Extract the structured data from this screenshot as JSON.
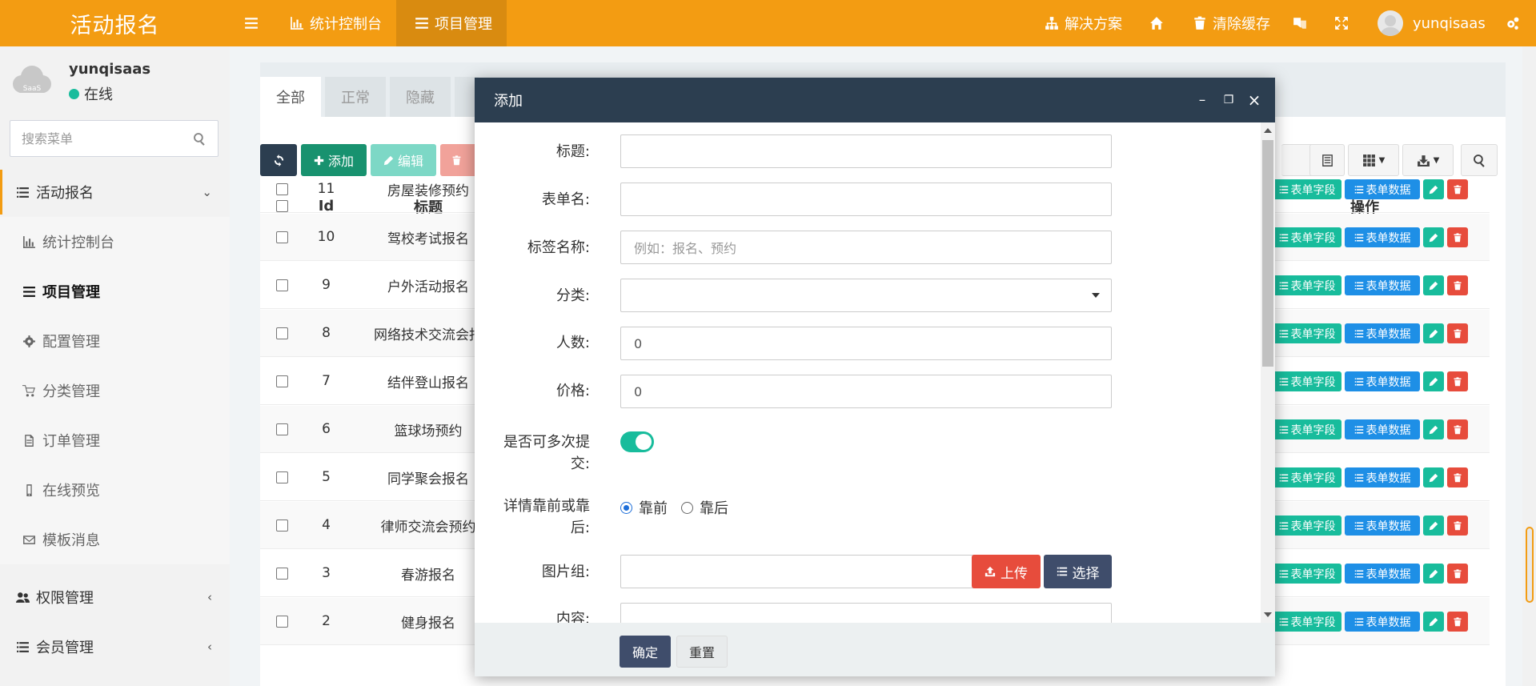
{
  "app": {
    "brand": "活动报名"
  },
  "topnav": {
    "left": [
      {
        "label": "统计控制台"
      },
      {
        "label": "项目管理"
      }
    ],
    "right": {
      "solution": "解决方案",
      "clear_cache": "清除缓存",
      "username": "yunqisaas"
    }
  },
  "sidebar": {
    "user": {
      "name": "yunqisaas",
      "status": "在线",
      "logo_text": "SaaS"
    },
    "search_placeholder": "搜索菜单",
    "groups": [
      {
        "label": "活动报名"
      },
      {
        "label": "权限管理"
      },
      {
        "label": "会员管理"
      }
    ],
    "items": [
      {
        "label": "统计控制台"
      },
      {
        "label": "项目管理"
      },
      {
        "label": "配置管理"
      },
      {
        "label": "分类管理"
      },
      {
        "label": "订单管理"
      },
      {
        "label": "在线预览"
      },
      {
        "label": "模板消息"
      }
    ]
  },
  "content": {
    "tabs": [
      {
        "label": "全部"
      },
      {
        "label": "正常"
      },
      {
        "label": "隐藏"
      }
    ],
    "toolbar": {
      "add": "添加",
      "edit": "编辑"
    },
    "table": {
      "columns": {
        "id": "Id",
        "title": "标题",
        "ops": "操作"
      },
      "op_labels": {
        "fields": "表单字段",
        "data": "表单数据"
      },
      "rows": [
        {
          "id": "11",
          "title": "房屋装修预约"
        },
        {
          "id": "10",
          "title": "驾校考试报名"
        },
        {
          "id": "9",
          "title": "户外活动报名"
        },
        {
          "id": "8",
          "title": "网络技术交流会报"
        },
        {
          "id": "7",
          "title": "结伴登山报名"
        },
        {
          "id": "6",
          "title": "篮球场预约"
        },
        {
          "id": "5",
          "title": "同学聚会报名"
        },
        {
          "id": "4",
          "title": "律师交流会预约"
        },
        {
          "id": "3",
          "title": "春游报名"
        },
        {
          "id": "2",
          "title": "健身报名"
        }
      ]
    }
  },
  "modal": {
    "title": "添加",
    "fields": {
      "title_label": "标题:",
      "form_name_label": "表单名:",
      "tag_label": "标签名称:",
      "tag_placeholder": "例如：报名、预约",
      "category_label": "分类:",
      "people_label": "人数:",
      "people_value": "0",
      "price_label": "价格:",
      "price_value": "0",
      "multi_label_1": "是否可多次提",
      "multi_label_2": "交:",
      "multi_on": true,
      "pos_label_1": "详情靠前或靠",
      "pos_label_2": "后:",
      "pos_front": "靠前",
      "pos_back": "靠后",
      "pos_selected": "靠前",
      "images_label": "图片组:",
      "upload": "上传",
      "choose": "选择",
      "content_label": "内容:"
    },
    "footer": {
      "confirm": "确定",
      "reset": "重置"
    }
  },
  "colors": {
    "brand_orange": "#f39c12",
    "modal_header": "#2c3e50",
    "success": "#18bc9c",
    "info": "#1e8fe6",
    "danger": "#e74c3c"
  }
}
